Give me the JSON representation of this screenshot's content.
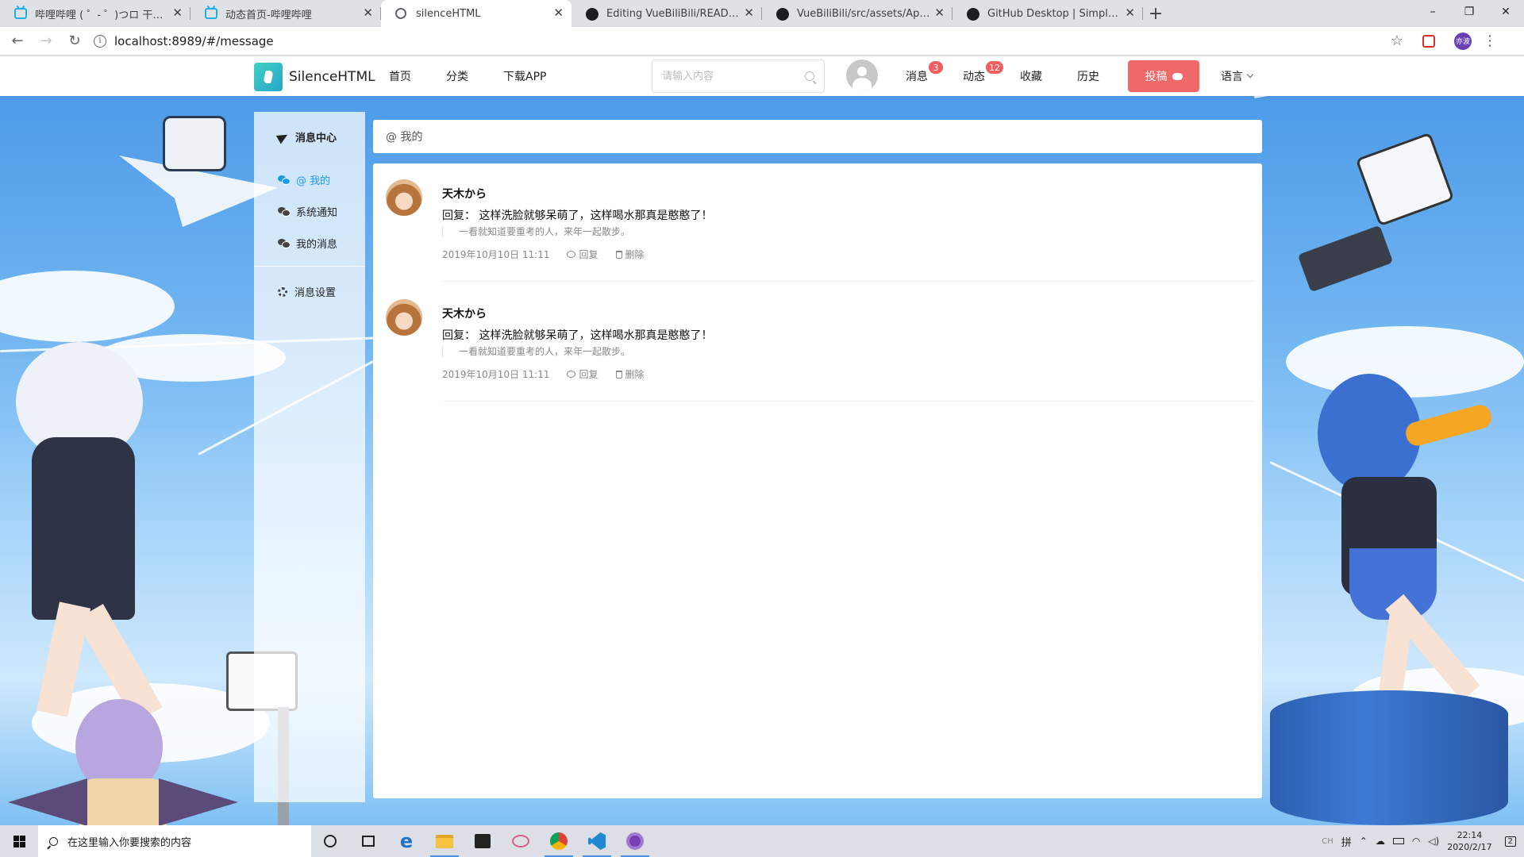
{
  "browser": {
    "tabs": [
      {
        "title": "哔哩哔哩 ( ゜- ゜)つロ 干杯~-bilibili",
        "icon": "bilibili-icon",
        "active": false
      },
      {
        "title": "动态首页-哔哩哔哩",
        "icon": "bilibili-icon",
        "active": false
      },
      {
        "title": "silenceHTML",
        "icon": "globe-icon",
        "active": true
      },
      {
        "title": "Editing VueBiliBili/README.md",
        "icon": "github-icon",
        "active": false
      },
      {
        "title": "VueBiliBili/src/assets/AppShot",
        "icon": "github-icon",
        "active": false
      },
      {
        "title": "GitHub Desktop | Simple collab",
        "icon": "github-icon",
        "active": false
      }
    ],
    "new_tab": "+",
    "close_glyph": "✕",
    "window_controls": [
      "–",
      "❐",
      "✕"
    ],
    "url": "localhost:8989/#/message",
    "profile_label": "亦波"
  },
  "header": {
    "logo_text": "SilenceHTML",
    "nav": [
      "首页",
      "分类",
      "下载APP"
    ],
    "search_placeholder": "请输入内容",
    "messages_label": "消息",
    "messages_badge": "3",
    "dynamic_label": "动态",
    "dynamic_badge": "12",
    "favorites_label": "收藏",
    "history_label": "历史",
    "post_label": "投稿",
    "language_label": "语言"
  },
  "sidebar": {
    "title": "消息中心",
    "items": [
      {
        "label": "@ 我的",
        "active": true
      },
      {
        "label": "系统通知",
        "active": false
      },
      {
        "label": "我的消息",
        "active": false
      }
    ],
    "settings_label": "消息设置"
  },
  "main": {
    "header_title": "@ 我的",
    "messages": [
      {
        "user": "天木から",
        "text": "回复：  这样洗脸就够呆萌了，这样喝水那真是憨憨了！",
        "quote": "一看就知道要重考的人，来年一起散步。",
        "time": "2019年10月10日 11:11",
        "reply_label": "回复",
        "delete_label": "删除"
      },
      {
        "user": "天木から",
        "text": "回复：  这样洗脸就够呆萌了，这样喝水那真是憨憨了！",
        "quote": "一看就知道要重考的人，来年一起散步。",
        "time": "2019年10月10日 11:11",
        "reply_label": "回复",
        "delete_label": "删除"
      }
    ]
  },
  "taskbar": {
    "search_text": "在这里输入你要搜索的内容",
    "apps": [
      "cortana-icon",
      "task-view-icon",
      "edge-icon",
      "file-explorer-icon",
      "store-icon",
      "paint-icon",
      "chrome-icon",
      "vscode-icon",
      "media-icon"
    ],
    "ime_label": "CH",
    "ime_mode": "拼",
    "time": "22:14",
    "date": "2020/2/17",
    "notification_count": "2"
  },
  "colors": {
    "accent": "#1a9be6",
    "post_button": "#f06969",
    "badge": "#f25d5d",
    "logo": "#2aa5c8"
  }
}
